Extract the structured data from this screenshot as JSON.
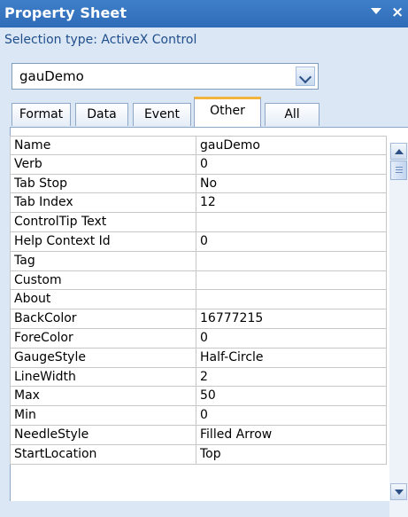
{
  "window": {
    "title": "Property Sheet",
    "selection_type_label": "Selection type:  ActiveX Control",
    "title_menu_icon": "dropdown-arrow-icon",
    "close_icon": "close-icon"
  },
  "object_selector": {
    "value": "gauDemo",
    "dropdown_icon": "chevron-down-icon"
  },
  "tabs": [
    {
      "label": "Format"
    },
    {
      "label": "Data"
    },
    {
      "label": "Event"
    },
    {
      "label": "Other",
      "active": true
    },
    {
      "label": "All"
    }
  ],
  "properties": [
    {
      "name": "Name",
      "value": "gauDemo"
    },
    {
      "name": "Verb",
      "value": "0"
    },
    {
      "name": "Tab Stop",
      "value": "No"
    },
    {
      "name": "Tab Index",
      "value": "12"
    },
    {
      "name": "ControlTip Text",
      "value": ""
    },
    {
      "name": "Help Context Id",
      "value": "0"
    },
    {
      "name": "Tag",
      "value": ""
    },
    {
      "name": "Custom",
      "value": ""
    },
    {
      "name": "About",
      "value": ""
    },
    {
      "name": "BackColor",
      "value": "16777215"
    },
    {
      "name": "ForeColor",
      "value": "0"
    },
    {
      "name": "GaugeStyle",
      "value": "Half-Circle"
    },
    {
      "name": "LineWidth",
      "value": "2"
    },
    {
      "name": "Max",
      "value": "50"
    },
    {
      "name": "Min",
      "value": "0"
    },
    {
      "name": "NeedleStyle",
      "value": "Filled Arrow"
    },
    {
      "name": "StartLocation",
      "value": "Top"
    }
  ],
  "colors": {
    "title_bar": "#2f6cb8",
    "panel_bg": "#dbe7f5",
    "active_tab_accent": "#f3b33d",
    "selection_text": "#1f4e8c"
  }
}
